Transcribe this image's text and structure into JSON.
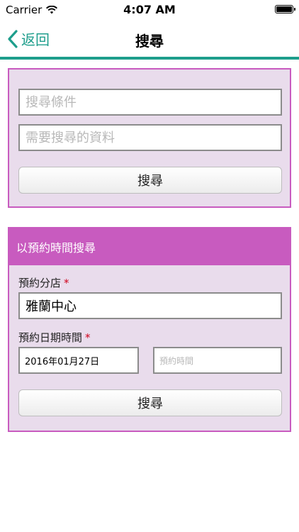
{
  "status_bar": {
    "carrier": "Carrier",
    "time": "4:07 AM"
  },
  "nav": {
    "back_label": "返回",
    "title": "搜尋"
  },
  "search_panel": {
    "condition_placeholder": "搜尋條件",
    "keyword_placeholder": "需要搜尋的資料",
    "search_button": "搜尋"
  },
  "booking_panel": {
    "header": "以預約時間搜尋",
    "branch_label": "預約分店",
    "branch_required": "*",
    "branch_value": "雅蘭中心",
    "datetime_label": "預約日期時間",
    "datetime_required": "*",
    "date_value": "2016年01月27日",
    "time_placeholder": "預約時間",
    "search_button": "搜尋"
  },
  "colors": {
    "accent": "#1e9e8c",
    "panel_border": "#c85bbf",
    "panel_bg": "#e9dcec",
    "required": "#d0021b"
  },
  "icons": {
    "back": "chevron-left-icon",
    "wifi": "wifi-icon",
    "battery": "battery-icon"
  }
}
